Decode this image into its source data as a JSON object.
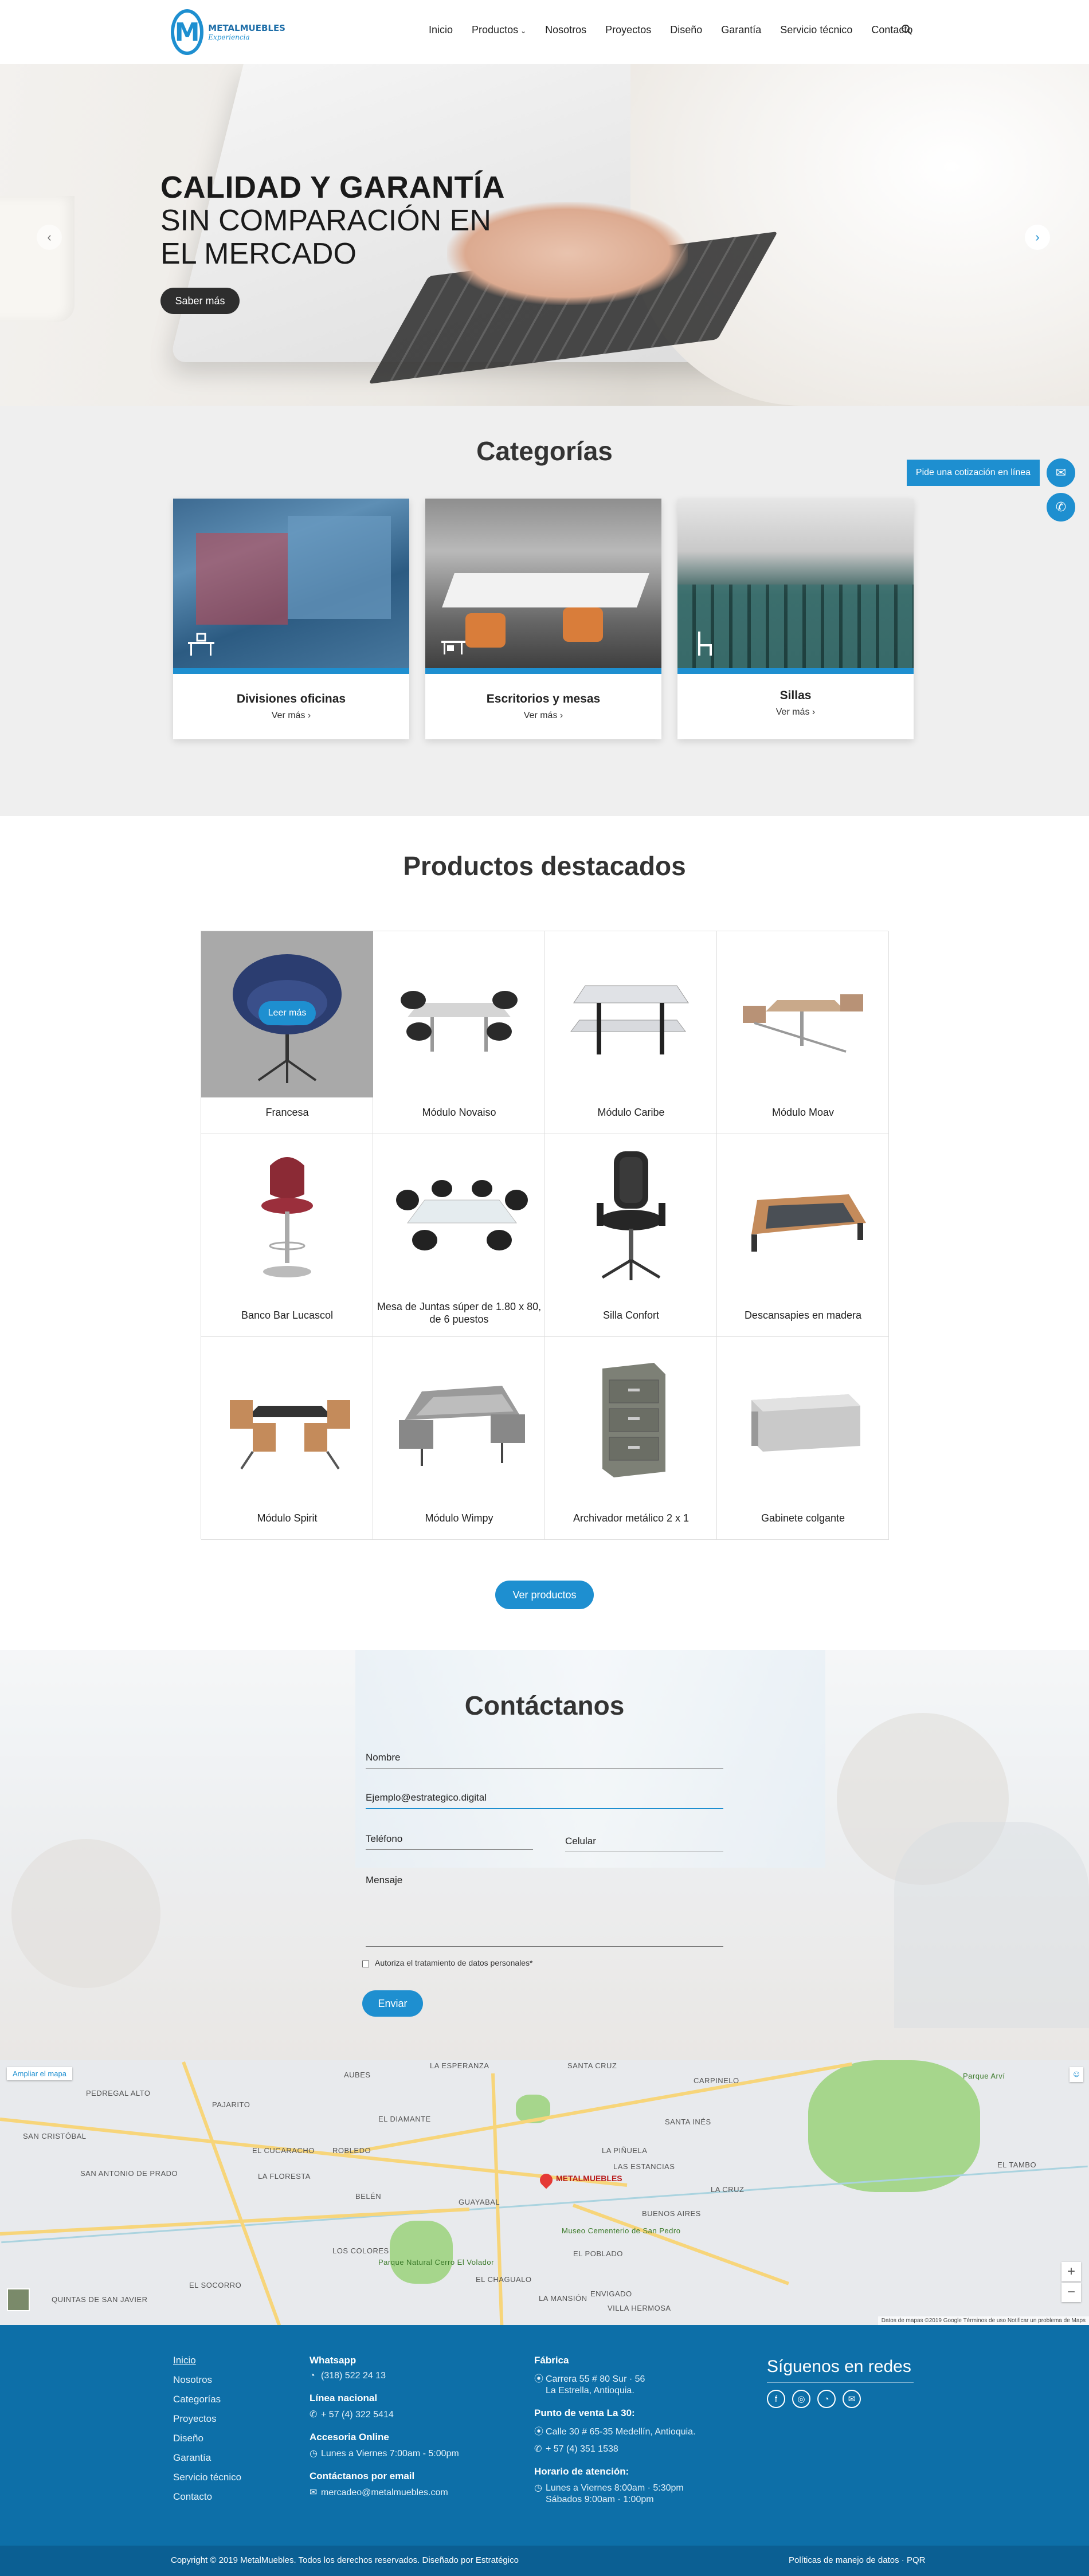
{
  "header": {
    "logo_name": "METALMUEBLES",
    "logo_tagline": "Experiencia",
    "nav": [
      "Inicio",
      "Productos",
      "Nosotros",
      "Proyectos",
      "Diseño",
      "Garantía",
      "Servicio técnico",
      "Contacto"
    ]
  },
  "hero": {
    "line1": "CALIDAD Y GARANTÍA",
    "line2": "SIN COMPARACIÓN EN",
    "line3": "EL MERCADO",
    "button": "Saber más",
    "prev": "‹",
    "next": "›"
  },
  "floating": {
    "quote": "Pide una cotización en línea"
  },
  "categories": {
    "title": "Categorías",
    "items": [
      {
        "name": "Divisiones oficinas",
        "more": "Ver más ›"
      },
      {
        "name": "Escritorios y mesas",
        "more": "Ver más ›"
      },
      {
        "name": "Sillas",
        "more": "Ver más ›"
      }
    ]
  },
  "products": {
    "title": "Productos destacados",
    "hover_label": "Leer más",
    "items": [
      "Francesa",
      "Módulo Novaiso",
      "Módulo Caribe",
      "Módulo Moav",
      "Banco Bar Lucascol",
      "Mesa de Juntas súper de 1.80 x 80, de 6 puestos",
      "Silla Confort",
      "Descansapies en madera",
      "Módulo Spirit",
      "Módulo Wimpy",
      "Archivador metálico 2 x 1",
      "Gabinete colgante"
    ],
    "button": "Ver productos"
  },
  "contact": {
    "title": "Contáctanos",
    "name_placeholder": "Nombre",
    "email_value": "Ejemplo@estrategico.digital",
    "phone_placeholder": "Teléfono",
    "cell_placeholder": "Celular",
    "message_placeholder": "Mensaje",
    "authorize": "Autoriza el tratamiento de datos personales*",
    "submit": "Enviar"
  },
  "map": {
    "enlarge": "Ampliar el mapa",
    "pin_label": "METALMUEBLES",
    "attribution": "Datos de mapas ©2019 Google   Términos de uso   Notificar un problema de Maps",
    "places": [
      "LA ESPERANZA",
      "SANTA CRUZ",
      "CARPINELO",
      "PEDREGAL ALTO",
      "PAJARITO",
      "AUBES",
      "SAN CRISTÓBAL",
      "EL DIAMANTE",
      "SAN ANTONIO DE PRADO",
      "EL CUCARACHO",
      "ROBLEDO",
      "LA FLORESTA",
      "BELÉN",
      "LOS COLORES",
      "GUAYABAL",
      "EL POBLADO",
      "ENVIGADO",
      "BUENOS AIRES",
      "LA CRUZ",
      "LA PIÑUELA",
      "LAS ESTANCIAS",
      "VILLA HERMOSA",
      "SANTA INÉS",
      "QUINTAS DE SAN JAVIER",
      "EL SOCORRO",
      "EL TAMBO",
      "EL CHAGUALO",
      "LA MANSIÓN",
      "Parque Arví",
      "Museo Cementerio de San Pedro",
      "Parque Natural Cerro El Volador"
    ]
  },
  "footer": {
    "links": [
      "Inicio",
      "Nosotros",
      "Categorías",
      "Proyectos",
      "Diseño",
      "Garantía",
      "Servicio técnico",
      "Contacto"
    ],
    "whatsapp_head": "Whatsapp",
    "whatsapp": "(318) 522 24 13",
    "linea_head": "Línea nacional",
    "linea": "+ 57 (4) 322 5414",
    "accesoria_head": "Accesoria Online",
    "accesoria": "Lunes a Viernes 7:00am - 5:00pm",
    "email_head": "Contáctanos por email",
    "email": "mercadeo@metalmuebles.com",
    "fabrica_head": "Fábrica",
    "fabrica_l1": "Carrera 55 # 80 Sur · 56",
    "fabrica_l2": "La Estrella, Antioquia.",
    "punto_head": "Punto de venta La 30:",
    "punto_addr": "Calle 30 # 65-35 Medellín, Antioquia.",
    "punto_tel": "+ 57 (4) 351 1538",
    "horario_head": "Horario de atención:",
    "horario_l1": "Lunes a Viernes 8:00am · 5:30pm",
    "horario_l2": "Sábados 9:00am · 1:00pm",
    "follow": "Síguenos en redes"
  },
  "bottom": {
    "copyright": "Copyright © 2019 MetalMuebles. Todos los derechos reservados. Diseñado por Estratégico",
    "policy": "Políticas de manejo de datos · PQR"
  },
  "colors": {
    "accent": "#1e8fd0",
    "footer": "#0d6fa8",
    "bottom_bar": "#0b5f93"
  }
}
